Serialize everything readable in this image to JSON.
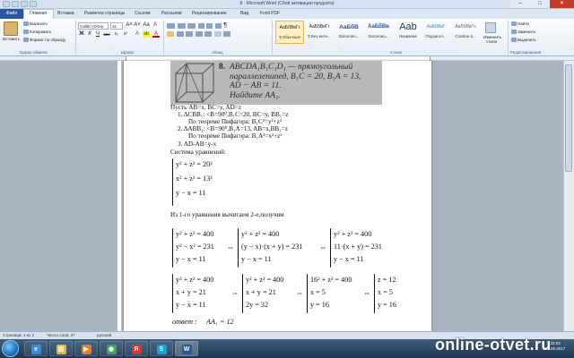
{
  "window": {
    "title": "8 - Microsoft Word (Сбой активации продукта)",
    "min": "–",
    "max": "□",
    "close": "✕"
  },
  "tabs": {
    "file": "Файл",
    "items": [
      "Главная",
      "Вставка",
      "Разметка страницы",
      "Ссылки",
      "Рассылки",
      "Рецензирование",
      "Вид",
      "Foxit PDF"
    ]
  },
  "ribbon": {
    "clipboard": {
      "paste": "Вставить",
      "cut": "Вырезать",
      "copy": "Копировать",
      "format_painter": "Формат по образцу",
      "label": "Буфер обмена"
    },
    "font": {
      "name": "Calibri (Осно",
      "size": "11",
      "bold": "Ж",
      "italic": "К",
      "underline": "Ч",
      "strike": "abc",
      "sub": "x₂",
      "sup": "x²",
      "grow": "A˄",
      "shrink": "A˅",
      "case": "Aa",
      "clear": "A",
      "highlight": "ab",
      "color": "A",
      "label": "Шрифт"
    },
    "paragraph": {
      "label": "Абзац",
      "mark": "¶"
    },
    "styles": {
      "items": [
        {
          "sample": "АаБбВвГг",
          "name": "¶ Обычный"
        },
        {
          "sample": "АаБбВвГг",
          "name": "¶ Без инте..."
        },
        {
          "sample": "АаБбВ",
          "name": "Заголово..."
        },
        {
          "sample": "АаБбВв",
          "name": "Заголово..."
        },
        {
          "sample": "Aab",
          "name": "Название"
        },
        {
          "sample": "АаБбВвГ",
          "name": "Подзагол..."
        },
        {
          "sample": "АаБбВвГг",
          "name": "Слабое в..."
        }
      ],
      "change": "Изменить стили",
      "label": "Стили"
    },
    "editing": {
      "find": "Найти",
      "replace": "Заменить",
      "select": "Выделить",
      "label": "Редактирование"
    }
  },
  "problem": {
    "number": "8.",
    "line1": "ABCDA₁B₁C₁D₁ — прямоугольный",
    "line2": "параллелепипед, B₁C = 20, B₁A = 13,",
    "line3": "AD − AB = 11.",
    "line4": "Найдите AA₁."
  },
  "solution": {
    "let": "Пусть AB=x, BC=y, AD=z",
    "s1": "1.  ΔCBB₁: <B=90⁰,B₁C=20, BC=y, BB₁=z",
    "s1b": "По теореме Пифагора:   B₁C²=y²+z²",
    "s2": "2.  ΔABB₁: <B=90⁰,B₁A=13, AB=x,BB₁=z",
    "s2b": "По теореме Пифагора:   B₁A²=x²+z²",
    "s3": "3.  AD-AB=y-x",
    "system_label": "Система уравнений:",
    "sys": [
      "y² + z² = 20²",
      "x² + z² = 13²",
      "y − x = 11"
    ],
    "subtract": "Из 1-го уравнения вычитаем 2-е,получим",
    "r1a": [
      "y² + z² = 400",
      "y² − x² = 231",
      "y − x = 11"
    ],
    "r1b": [
      "y² + z² = 400",
      "(y − x)·(x + y) = 231",
      "y − x = 11"
    ],
    "r1c": [
      "y² + z² = 400",
      "11·(x + y) = 231",
      "y − x = 11"
    ],
    "r2a": [
      "y² + z² = 400",
      "x + y = 21",
      "y − x = 11"
    ],
    "r2b": [
      "y² + z² = 400",
      "x + y = 21",
      "2y = 32"
    ],
    "r2c": [
      "16² + z² = 400",
      "x = 5",
      "y = 16"
    ],
    "r2d": [
      "z = 12",
      "x = 5",
      "y = 16"
    ],
    "arrow": "⇔",
    "answer_label": "ответ :",
    "answer": "AA₁ = 12"
  },
  "status": {
    "page": "Страница: 1 из 2",
    "words": "Число слов: 37",
    "lang": "русский"
  },
  "taskbar": {
    "apps": [
      {
        "icon": "ie-icon",
        "glyph": "e",
        "color": "#2f8de4"
      },
      {
        "icon": "folder-icon",
        "glyph": "▤",
        "color": "#e8b43a"
      },
      {
        "icon": "media-player-icon",
        "glyph": "▶",
        "color": "#e87c1e"
      },
      {
        "icon": "chrome-icon",
        "glyph": "◉",
        "color": "#3aa757"
      },
      {
        "icon": "yandex-icon",
        "glyph": "Я",
        "color": "#d33"
      },
      {
        "icon": "skype-icon",
        "glyph": "S",
        "color": "#1aa3e0"
      },
      {
        "icon": "word-icon",
        "glyph": "W",
        "color": "#2b579a"
      }
    ]
  },
  "watermark": "online-otvet.ru",
  "clock": {
    "time": "22:03",
    "date": "06.05.2017"
  }
}
